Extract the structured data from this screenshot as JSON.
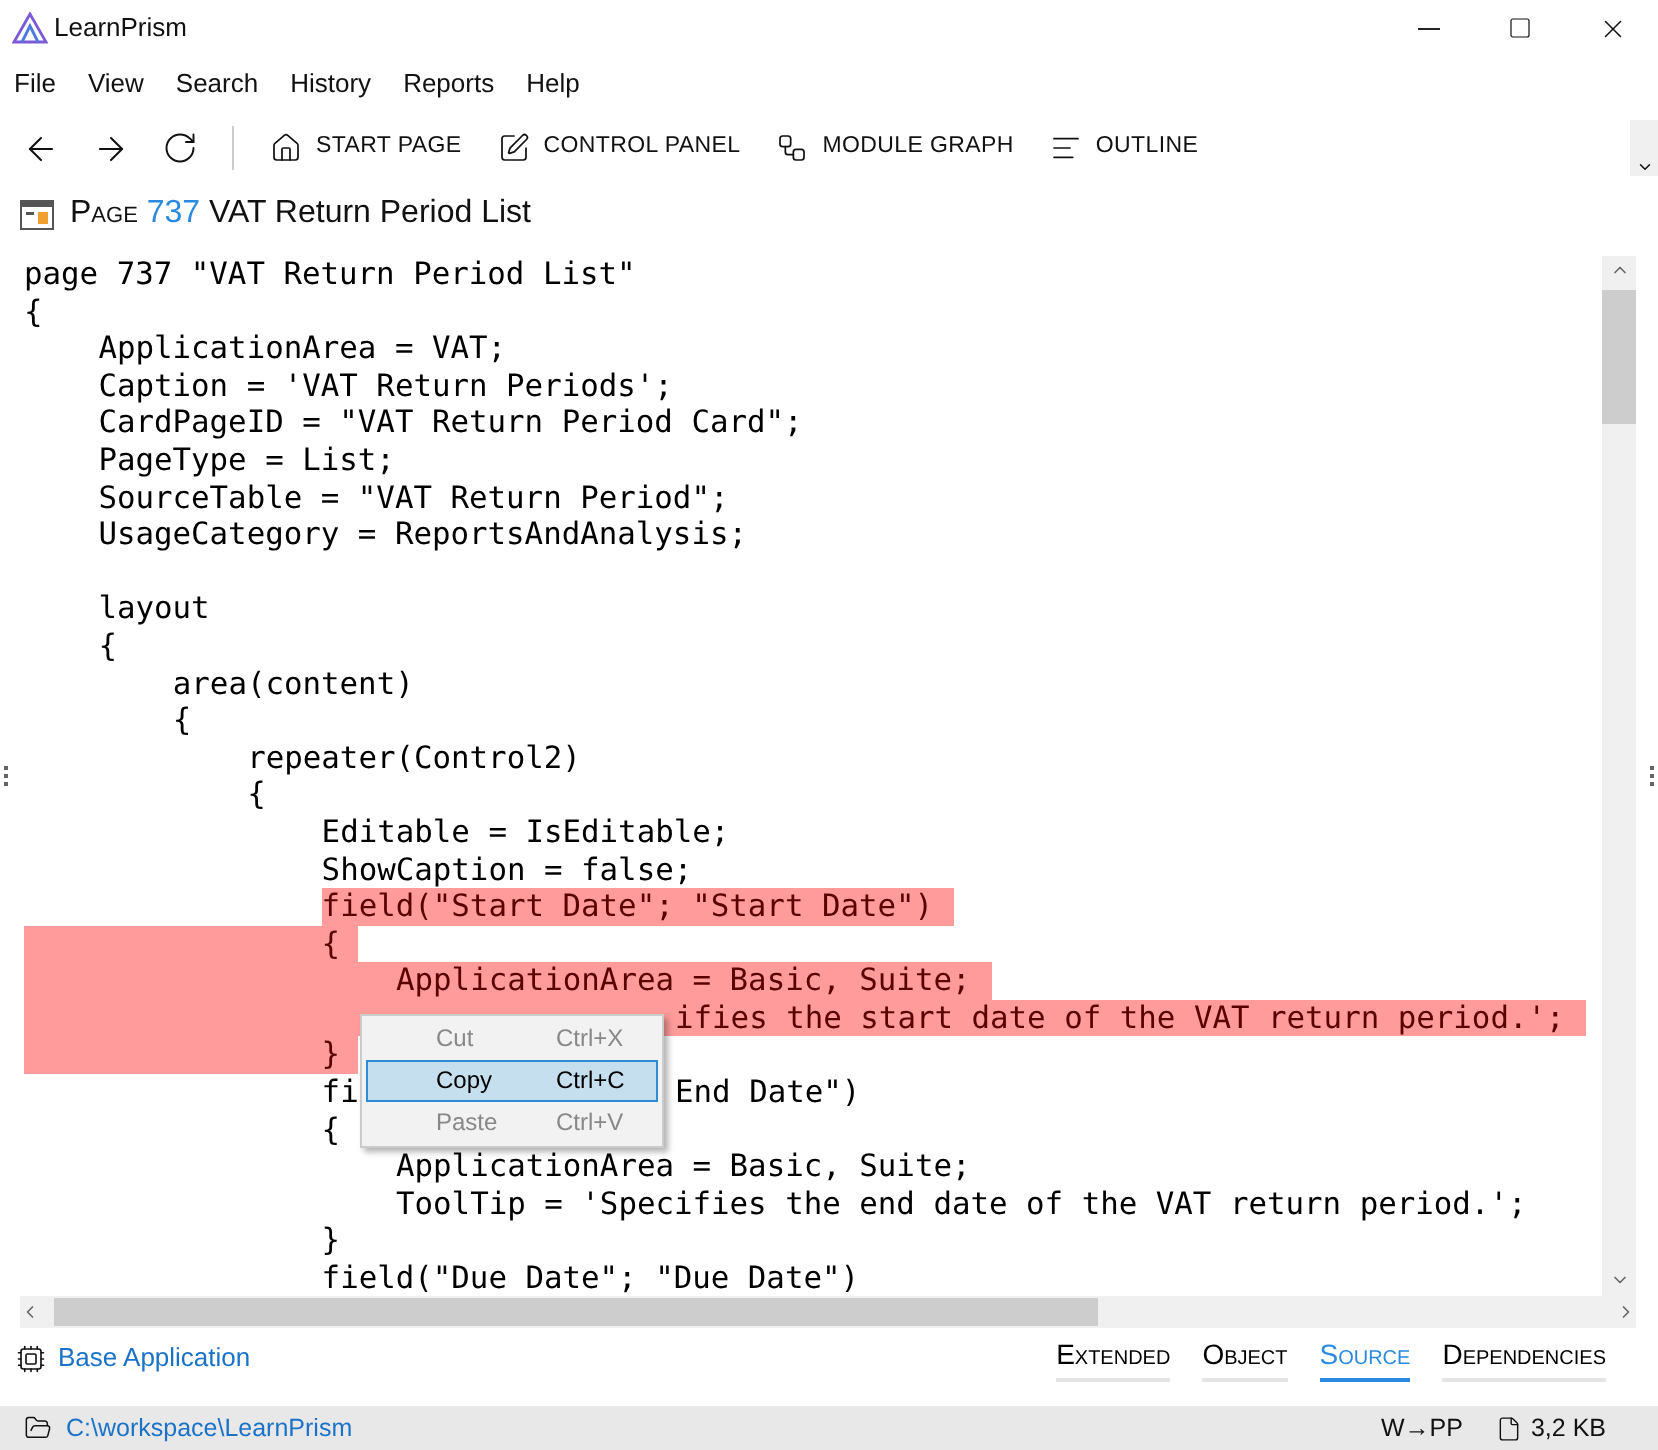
{
  "window": {
    "title": "LearnPrism"
  },
  "menu": [
    "File",
    "View",
    "Search",
    "History",
    "Reports",
    "Help"
  ],
  "toolbar": [
    {
      "kind": "home",
      "label": "START PAGE"
    },
    {
      "kind": "panel",
      "label": "CONTROL PANEL"
    },
    {
      "kind": "graph",
      "label": "MODULE GRAPH"
    },
    {
      "kind": "outline",
      "label": "OUTLINE"
    }
  ],
  "header": {
    "prefix": "Page",
    "number": "737",
    "title": "VAT Return Period List"
  },
  "code": [
    {
      "kind": "code",
      "text": "page 737 \"VAT Return Period List\"",
      "selected": false
    },
    {
      "kind": "code",
      "text": "{",
      "selected": false
    },
    {
      "kind": "code",
      "text": "    ApplicationArea = VAT;",
      "selected": false
    },
    {
      "kind": "code",
      "text": "    Caption = 'VAT Return Periods';",
      "selected": false
    },
    {
      "kind": "code",
      "text": "    CardPageID = \"VAT Return Period Card\";",
      "selected": false
    },
    {
      "kind": "code",
      "text": "    PageType = List;",
      "selected": false
    },
    {
      "kind": "code",
      "text": "    SourceTable = \"VAT Return Period\";",
      "selected": false
    },
    {
      "kind": "code",
      "text": "    UsageCategory = ReportsAndAnalysis;",
      "selected": false
    },
    {
      "kind": "blank"
    },
    {
      "kind": "code",
      "text": "    layout",
      "selected": false
    },
    {
      "kind": "code",
      "text": "    {",
      "selected": false
    },
    {
      "kind": "code",
      "text": "        area(content)",
      "selected": false
    },
    {
      "kind": "code",
      "text": "        {",
      "selected": false
    },
    {
      "kind": "code",
      "text": "            repeater(Control2)",
      "selected": false
    },
    {
      "kind": "code",
      "text": "            {",
      "selected": false
    },
    {
      "kind": "code",
      "text": "                Editable = IsEditable;",
      "selected": false
    },
    {
      "kind": "code",
      "text": "                ShowCaption = false;",
      "selected": false
    },
    {
      "kind": "code",
      "text": "                field(\"Start Date\"; \"Start Date\")",
      "selected": true,
      "selection_from_margin": false
    },
    {
      "kind": "code",
      "text": "                {",
      "selected": true,
      "selection_from_margin": true
    },
    {
      "kind": "code",
      "text": "                    ApplicationArea = Basic, Suite;",
      "selected": true,
      "selection_from_margin": true
    },
    {
      "kind": "code",
      "text": "                                   ifies the start date of the VAT return period.';",
      "selected": true,
      "selection_from_margin": true
    },
    {
      "kind": "code",
      "text": "                }",
      "selected": true,
      "selection_from_margin": true
    },
    {
      "kind": "code",
      "text": "                fi                 End Date\")",
      "selected": false
    },
    {
      "kind": "code",
      "text": "                {",
      "selected": false
    },
    {
      "kind": "code",
      "text": "                    ApplicationArea = Basic, Suite;",
      "selected": false
    },
    {
      "kind": "code",
      "text": "                    ToolTip = 'Specifies the end date of the VAT return period.';",
      "selected": false
    },
    {
      "kind": "code",
      "text": "                }",
      "selected": false
    },
    {
      "kind": "code",
      "text": "                field(\"Due Date\"; \"Due Date\")",
      "selected": false
    }
  ],
  "context_menu": [
    {
      "label": "Cut",
      "shortcut": "Ctrl+X",
      "disabled": true,
      "selected": false
    },
    {
      "label": "Copy",
      "shortcut": "Ctrl+C",
      "disabled": false,
      "selected": true
    },
    {
      "label": "Paste",
      "shortcut": "Ctrl+V",
      "disabled": true,
      "selected": false
    }
  ],
  "module": {
    "label": "Base Application"
  },
  "view_tabs": [
    {
      "label": "Extended",
      "selected": false
    },
    {
      "label": "Object",
      "selected": false
    },
    {
      "label": "Source",
      "selected": true
    },
    {
      "label": "Dependencies",
      "selected": false
    }
  ],
  "status_bar": {
    "path": "C:\\workspace\\LearnPrism",
    "encoding": "W→PP",
    "size": "3,2 KB"
  }
}
